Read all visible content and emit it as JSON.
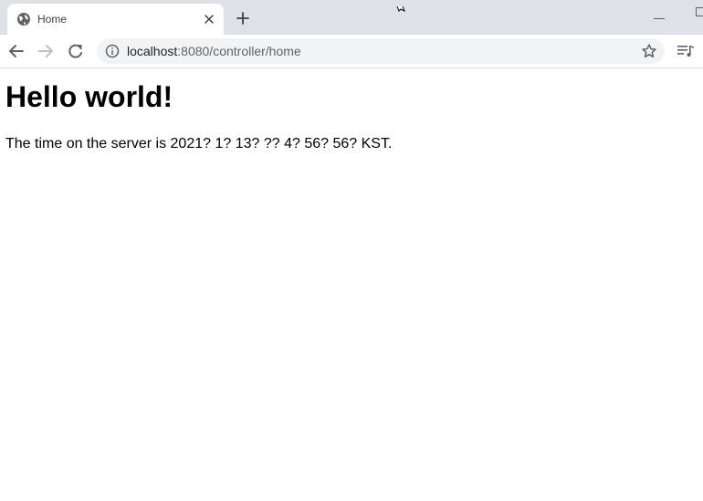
{
  "tab": {
    "title": "Home",
    "favicon": "globe-icon"
  },
  "toolbar": {
    "url_host": "localhost",
    "url_rest": ":8080/controller/home"
  },
  "page": {
    "heading": "Hello world!",
    "server_time": "The time on the server is 2021? 1? 13? ?? 4? 56? 56? KST."
  },
  "colors": {
    "tabstrip": "#dee1e6",
    "omnibox": "#f1f3f4",
    "icon": "#5f6368",
    "text": "#000000"
  }
}
